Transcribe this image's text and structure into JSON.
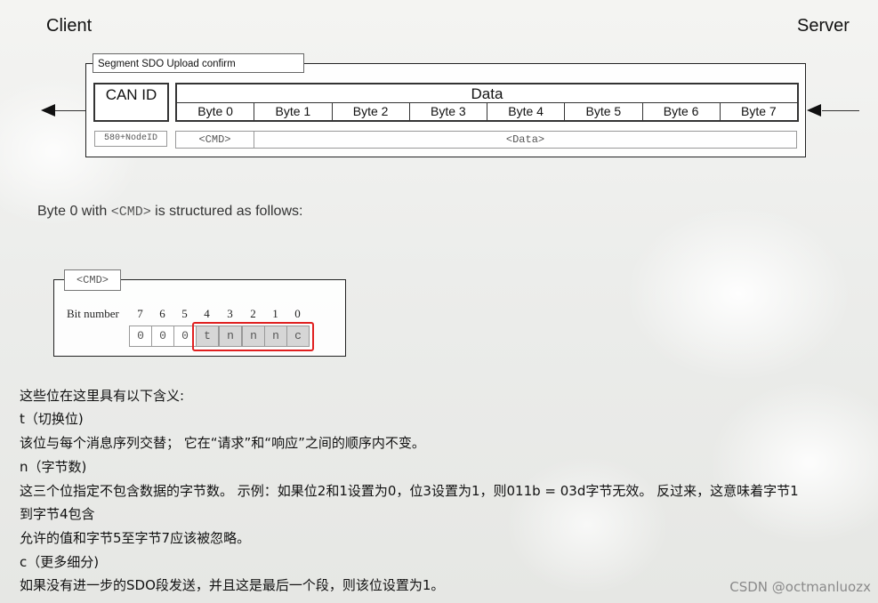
{
  "roles": {
    "client": "Client",
    "server": "Server"
  },
  "frame1": {
    "title": "Segment SDO Upload confirm",
    "can_id_header": "CAN ID",
    "data_header": "Data",
    "bytes": [
      "Byte 0",
      "Byte 1",
      "Byte 2",
      "Byte 3",
      "Byte 4",
      "Byte 5",
      "Byte 6",
      "Byte 7"
    ],
    "node_id": "580+NodeID",
    "cmd": "<CMD>",
    "data": "<Data>"
  },
  "sentence": {
    "pre": "Byte 0 with ",
    "code": "<CMD>",
    "post": " is structured as follows:"
  },
  "frame2": {
    "title": "<CMD>",
    "bit_number_label": "Bit number",
    "bit_numbers": [
      "7",
      "6",
      "5",
      "4",
      "3",
      "2",
      "1",
      "0"
    ],
    "bit_values": [
      "0",
      "0",
      "0",
      "t",
      "n",
      "n",
      "n",
      "c"
    ]
  },
  "text_lines": [
    "这些位在这里具有以下含义:",
    "t（切换位)",
    "该位与每个消息序列交替； 它在“请求”和“响应”之间的顺序内不变。",
    "n（字节数)",
    "这三个位指定不包含数据的字节数。 示例：如果位2和1设置为0，位3设置为1，则011b = 03d字节无效。 反过来，这意味着字节1",
    "到字节4包含",
    "允许的值和字节5至字节7应该被忽略。",
    "c（更多细分)",
    "如果没有进一步的SDO段发送，并且这是最后一个段，则该位设置为1。"
  ],
  "watermark": "CSDN @octmanluozx"
}
